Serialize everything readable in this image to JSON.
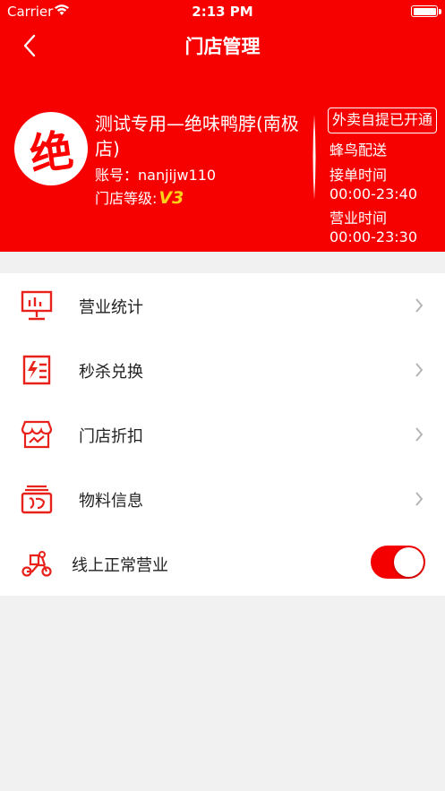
{
  "status_bar": {
    "carrier": "Carrier",
    "time": "2:13 PM"
  },
  "nav": {
    "title": "门店管理",
    "back_icon": "chevron-left-icon"
  },
  "store": {
    "logo_char": "绝",
    "name": "测试专用—绝味鸭脖(南极店)",
    "account_label": "账号：",
    "account": "nanjijw110",
    "level_label": "门店等级:",
    "level": "V3",
    "takeout_tag": "外卖自提已开通",
    "delivery": "蜂鸟配送",
    "order_time_label": "接单时间",
    "order_time": "00:00-23:40",
    "business_time_label": "营业时间",
    "business_time": "00:00-23:30"
  },
  "menu": {
    "items": [
      {
        "label": "营业统计",
        "icon": "chart-board-icon"
      },
      {
        "label": "秒杀兑换",
        "icon": "lightning-list-icon"
      },
      {
        "label": "门店折扣",
        "icon": "shop-icon"
      },
      {
        "label": "物料信息",
        "icon": "material-box-icon"
      }
    ],
    "online_toggle": {
      "label": "线上正常营业",
      "icon": "delivery-scooter-icon",
      "on": true
    }
  },
  "colors": {
    "brand_red": "#f60000",
    "icon_red": "#e8221b",
    "level_yellow": "#ffd21a",
    "background": "#f1f1f1"
  }
}
